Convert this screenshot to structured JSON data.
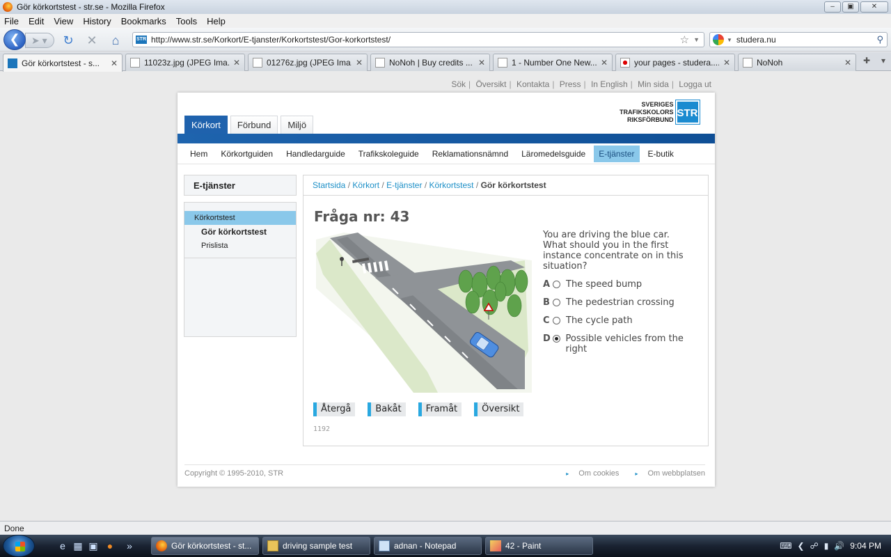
{
  "window": {
    "title": "Gör körkortstest - str.se - Mozilla Firefox"
  },
  "menu": [
    "File",
    "Edit",
    "View",
    "History",
    "Bookmarks",
    "Tools",
    "Help"
  ],
  "nav": {
    "url": "http://www.str.se/Korkort/E-tjanster/Korkortstest/Gor-korkortstest/",
    "search_value": "studera.nu"
  },
  "tabs": [
    {
      "label": "Gör körkortstest - s...",
      "icon": "str-icon",
      "active": true
    },
    {
      "label": "11023z.jpg (JPEG Ima...",
      "icon": "image-icon"
    },
    {
      "label": "01276z.jpg (JPEG Ima...",
      "icon": "image-icon"
    },
    {
      "label": "NoNoh | Buy credits ...",
      "icon": "page-icon"
    },
    {
      "label": "1 - Number One New...",
      "icon": "link-icon"
    },
    {
      "label": "your pages - studera....",
      "icon": "flag-icon"
    },
    {
      "label": "NoNoh",
      "icon": "page-icon"
    }
  ],
  "site": {
    "toplinks": [
      "Sök",
      "Översikt",
      "Kontakta",
      "Press",
      "In English",
      "Min sida",
      "Logga ut"
    ],
    "main_tabs": [
      "Körkort",
      "Förbund",
      "Miljö"
    ],
    "brand_lines": [
      "SVERIGES",
      "TRAFIKSKOLORS",
      "RIKSFÖRBUND"
    ],
    "brand_box": "STR",
    "subnav": [
      "Hem",
      "Körkortguiden",
      "Handledarguide",
      "Trafikskoleguide",
      "Reklamationsnämnd",
      "Läromedelsguide",
      "E-tjänster",
      "E-butik"
    ],
    "sidebar": {
      "title": "E-tjänster",
      "items": [
        "Körkortstest",
        "Gör körkortstest",
        "Prislista"
      ]
    },
    "breadcrumb": [
      "Startsida",
      "Körkort",
      "E-tjänster",
      "Körkortstest",
      "Gör körkortstest"
    ],
    "question": {
      "title": "Fråga nr: 43",
      "text": "You are driving the blue car. What should you in the first instance concentrate on in this situation?",
      "answers": [
        {
          "letter": "A",
          "label": "The speed bump",
          "selected": false
        },
        {
          "letter": "B",
          "label": "The pedestrian crossing",
          "selected": false
        },
        {
          "letter": "C",
          "label": "The cycle path",
          "selected": false
        },
        {
          "letter": "D",
          "label": "Possible vehicles from the right",
          "selected": true
        }
      ],
      "buttons": [
        "Återgå",
        "Bakåt",
        "Framåt",
        "Översikt"
      ],
      "number": "1192"
    },
    "footer": {
      "copyright": "Copyright © 1995-2010, STR",
      "links": [
        "Om cookies",
        "Om webbplatsen"
      ]
    }
  },
  "status": "Done",
  "taskbar": {
    "tasks": [
      "Gör körkortstest - st...",
      "driving sample test",
      "adnan - Notepad",
      "42 - Paint"
    ],
    "time": "9:04 PM"
  }
}
